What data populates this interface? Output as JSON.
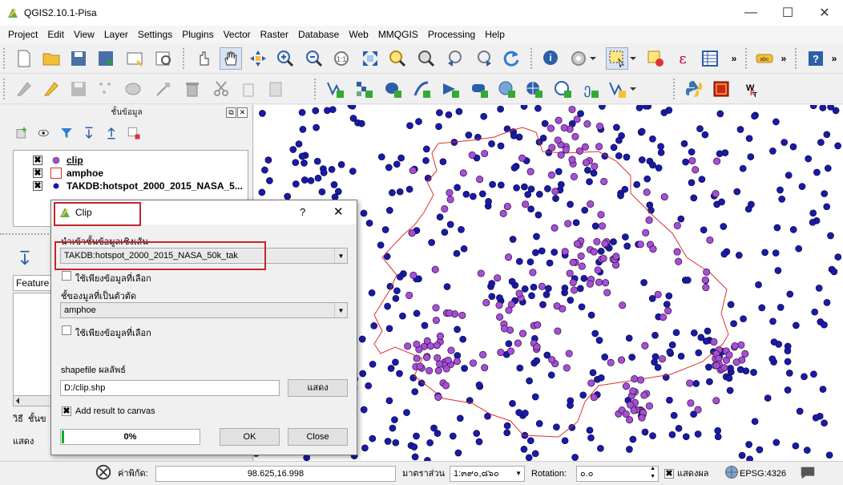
{
  "app": {
    "title": "QGIS2.10.1-Pisa"
  },
  "window_controls": {
    "minimize": "—",
    "maximize": "☐",
    "close": "✕"
  },
  "menu": [
    "Project",
    "Edit",
    "View",
    "Layer",
    "Settings",
    "Plugins",
    "Vector",
    "Raster",
    "Database",
    "Web",
    "MMQGIS",
    "Processing",
    "Help"
  ],
  "layers_panel": {
    "title": "ชั้นข้อมูล",
    "layers": [
      {
        "name": "clip",
        "checked": "✖",
        "symbol": "purple-point"
      },
      {
        "name": "amphoe",
        "checked": "✖",
        "symbol": "polygon-outline"
      },
      {
        "name": "TAKDB:hotspot_2000_2015_NASA_5...",
        "checked": "✖",
        "symbol": "blue-point"
      }
    ]
  },
  "side_panel": {
    "feature_label": "Feature",
    "tab_label": "วิธี",
    "tab2_label": "ชั้นข",
    "show_label": "แสดง"
  },
  "dialog": {
    "title": "Clip",
    "help": "?",
    "close": "✕",
    "input_label": "นำเข้าชั้นข้อมูลเชิงเส้น",
    "input_value": "TAKDB:hotspot_2000_2015_NASA_50k_tak",
    "input_selected_only": "ใช้เพียงข้อมูลที่เลือก",
    "clip_label": "ชั้ของมูลที่เป็นตัวตัด",
    "clip_value": "amphoe",
    "clip_selected_only": "ใช้เพียงข้อมูลที่เลือก",
    "output_label": "shapefile ผลลัพธ์",
    "output_value": "D:/clip.shp",
    "browse_button": "แสดง",
    "add_result_label": "Add result to canvas",
    "add_result_checked": "✖",
    "progress_text": "0%",
    "progress_value": 0,
    "ok_button": "OK",
    "close_button": "Close"
  },
  "statusbar": {
    "coordinate_label": "ค่าพิกัด:",
    "coordinate_value": "98.625,16.998",
    "scale_label": "มาตราส่วน",
    "scale_value": "1:๓๙๐,๘๖๐",
    "rotation_label": "Rotation:",
    "rotation_value": "๐.๐",
    "render_label": "แสดงผล",
    "render_checked": "✖",
    "crs": "EPSG:4326"
  },
  "colors": {
    "clip_points": "#a64fd6",
    "hotspot_points": "#1a1aa6",
    "boundary": "#e03030",
    "highlight": "#c0262c"
  }
}
